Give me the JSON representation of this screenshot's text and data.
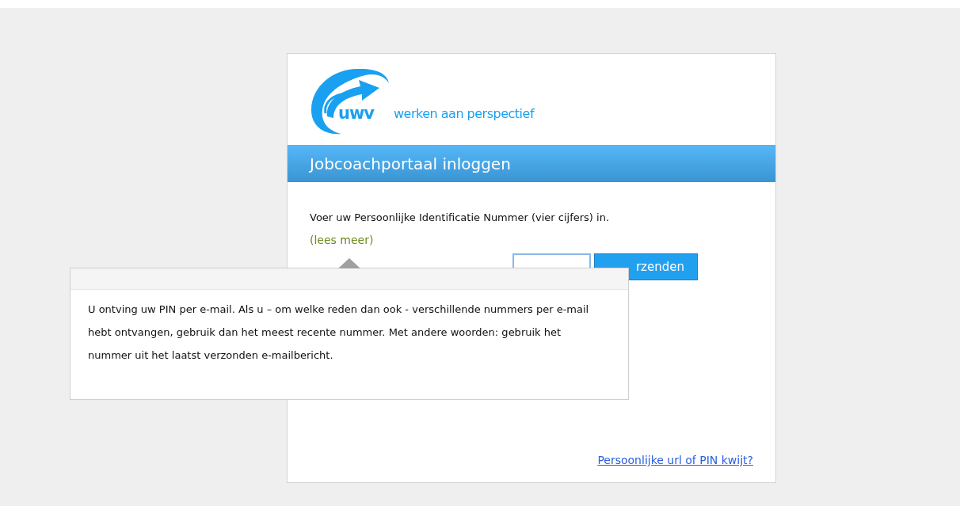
{
  "logo": {
    "wordmark": "uwv",
    "tagline": "werken aan perspectief"
  },
  "header": {
    "title": "Jobcoachportaal inloggen"
  },
  "form": {
    "instruction": "Voer uw Persoonlijke Identificatie Nummer (vier cijfers) in.",
    "more_link": "(lees meer)",
    "submit_button": "rzenden"
  },
  "forgot_link": "Persoonlijke url of PIN kwijt?",
  "tooltip": {
    "text": "U ontving uw PIN per e-mail. Als u – om welke reden dan ook - verschillende nummers per e-mail hebt ontvangen, gebruik dan het meest recente nummer. Met andere woorden: gebruik het nummer uit het laatst verzonden e-mailbericht."
  }
}
